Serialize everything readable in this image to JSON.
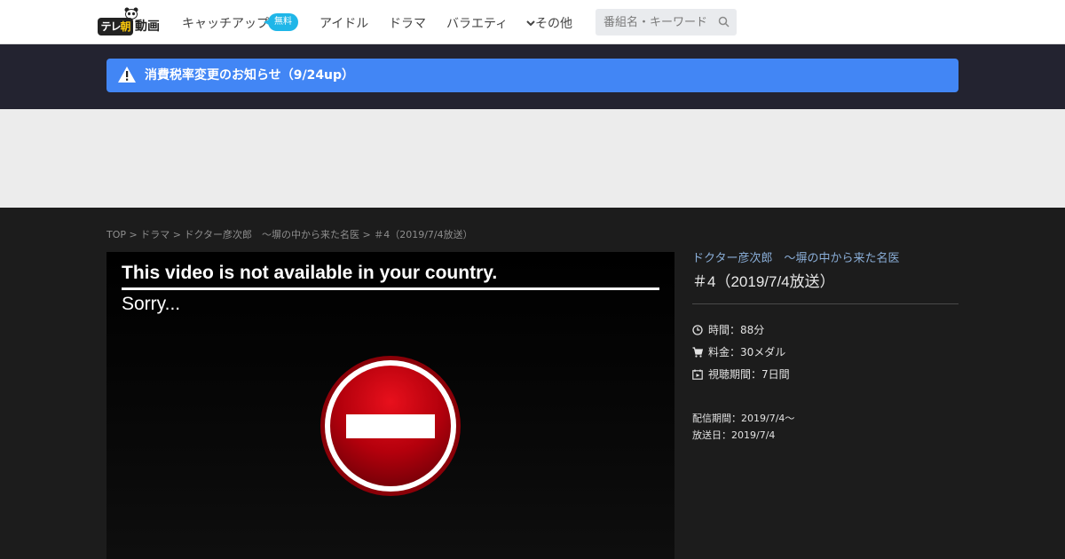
{
  "header": {
    "logo_text": "テレ朝動画",
    "nav": [
      {
        "label": "キャッチアップ"
      },
      {
        "label": "アイドル"
      },
      {
        "label": "ドラマ"
      },
      {
        "label": "バラエティ"
      },
      {
        "label": "その他"
      }
    ],
    "free_badge": "無料",
    "search_placeholder": "番組名・キーワード"
  },
  "notice": {
    "text": "消費税率変更のお知らせ（9/24up）"
  },
  "breadcrumb": [
    "TOP",
    "ドラマ",
    "ドクター彦次郎　～塀の中から来た名医",
    "＃4（2019/7/4放送）"
  ],
  "breadcrumb_separator": ">",
  "player": {
    "message": "This video is not available in your country.",
    "sorry": "Sorry..."
  },
  "info": {
    "program_title": "ドクター彦次郎　～塀の中から来た名医",
    "episode_title": "＃4（2019/7/4放送）",
    "duration": "時間：88分",
    "price": "料金：30メダル",
    "viewing_period": "視聴期間：7日間",
    "distribution_period": "配信期間：2019/7/4～",
    "broadcast_date": "放送日：2019/7/4"
  },
  "colors": {
    "accent_blue": "#4286f5",
    "badge_cyan": "#1fb6e8",
    "link_blue": "#8aaed8",
    "stop_red": "#c8000f"
  },
  "icons": {
    "warning": "warning-icon",
    "search": "search-icon",
    "clock": "clock-icon",
    "cart": "cart-icon",
    "calendar": "calendar-play-icon",
    "chevron": "chevron-down-icon",
    "stop": "no-entry-icon"
  }
}
